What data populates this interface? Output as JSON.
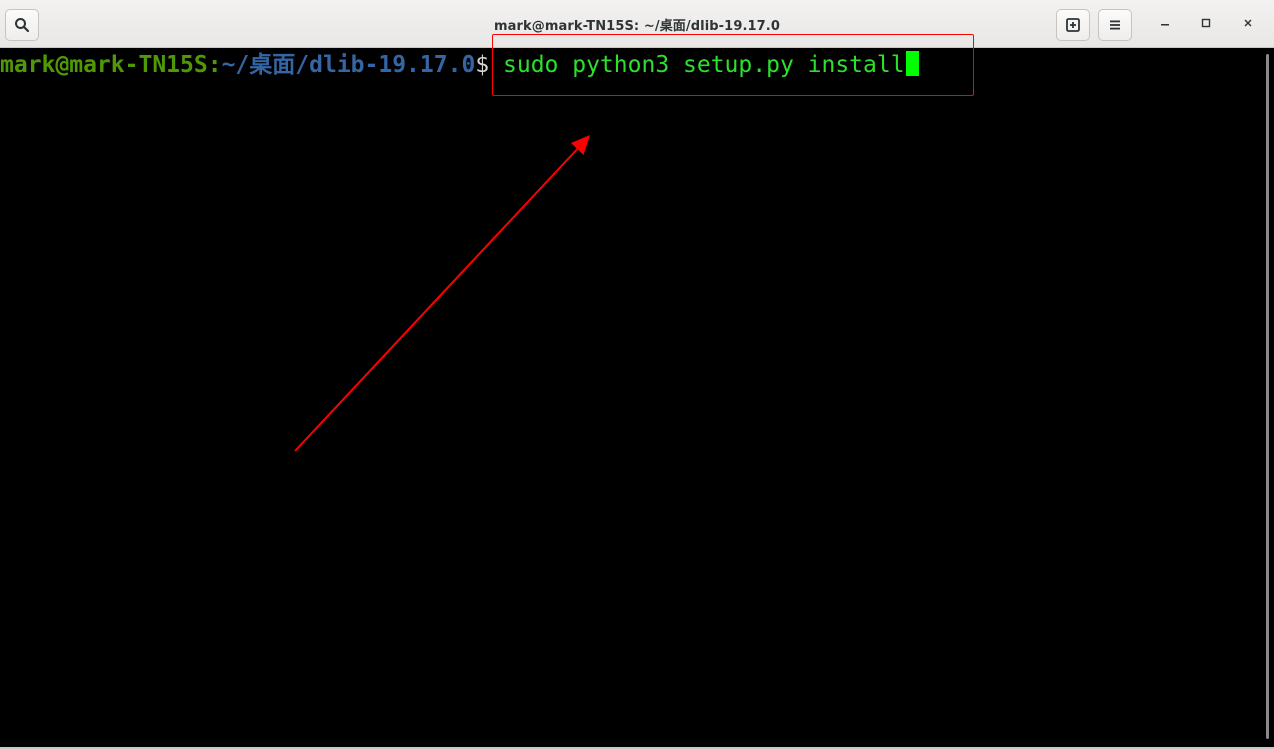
{
  "window": {
    "title": "mark@mark-TN15S: ~/桌面/dlib-19.17.0"
  },
  "toolbar": {
    "search_icon": "search-icon",
    "new_tab_icon": "new-tab-icon",
    "menu_icon": "hamburger-menu-icon",
    "minimize_icon": "minimize-icon",
    "maximize_icon": "maximize-icon",
    "close_icon": "close-icon"
  },
  "terminal": {
    "user_host": "mark@mark-TN15S",
    "separator": ":",
    "path": "~/桌面/dlib-19.17.0",
    "prompt_sign": "$",
    "command": " sudo python3 setup.py install"
  },
  "colors": {
    "user_host": "#4e9a06",
    "path": "#3465a4",
    "command": "#2de02d",
    "cursor": "#00ff00",
    "annotation": "#ff0000"
  }
}
